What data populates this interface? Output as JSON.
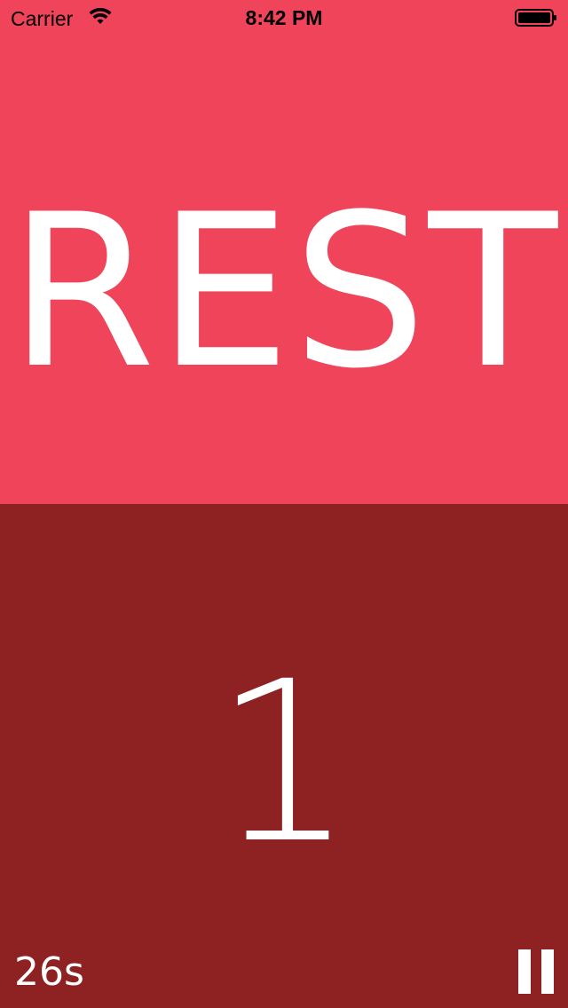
{
  "status_bar": {
    "carrier": "Carrier",
    "time": "8:42 PM",
    "wifi_icon": "wifi-icon",
    "battery_icon": "battery-icon"
  },
  "workout": {
    "phase": "REST",
    "round": "1",
    "time_remaining": "26s",
    "pause_icon": "pause-icon"
  },
  "colors": {
    "phase_background": "#ef4459",
    "round_background": "#8e2222",
    "text": "#ffffff"
  }
}
